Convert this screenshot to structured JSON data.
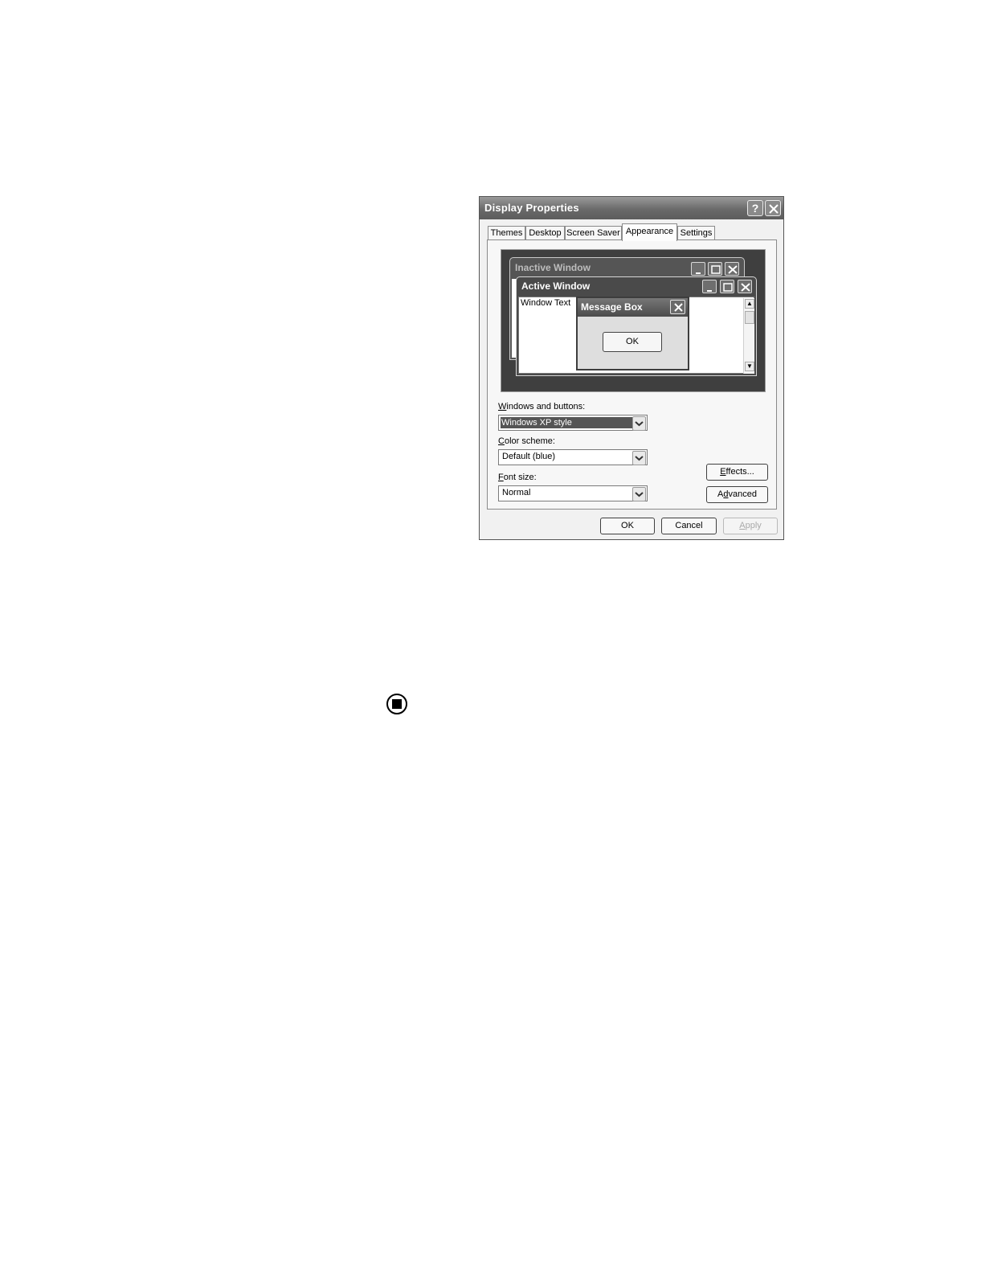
{
  "dialog": {
    "title": "Display Properties",
    "help_glyph": "?",
    "close_icon": "close-icon"
  },
  "tabs": [
    {
      "label": "Themes"
    },
    {
      "label": "Desktop"
    },
    {
      "label": "Screen Saver"
    },
    {
      "label": "Appearance",
      "active": true
    },
    {
      "label": "Settings"
    }
  ],
  "preview": {
    "inactive_title": "Inactive Window",
    "active_title": "Active Window",
    "window_text": "Window Text",
    "message_box_title": "Message Box",
    "message_box_ok": "OK"
  },
  "fields": {
    "windows_buttons": {
      "label_first": "W",
      "label_rest": "indows and buttons:",
      "value": "Windows XP style"
    },
    "color_scheme": {
      "label_first": "C",
      "label_rest": "olor scheme:",
      "value": "Default (blue)"
    },
    "font_size": {
      "label_first": "F",
      "label_rest": "ont size:",
      "value": "Normal"
    }
  },
  "side_buttons": {
    "effects": {
      "pre": "",
      "mnemonic": "E",
      "post": "ffects..."
    },
    "advanced": {
      "pre": "A",
      "mnemonic": "d",
      "post": "vanced"
    }
  },
  "footer_buttons": {
    "ok": "OK",
    "cancel_pre": "",
    "cancel_mnemonic": "",
    "cancel": "Cancel",
    "apply_mnemonic": "A",
    "apply_rest": "pply"
  },
  "colors": {
    "titlebar": "#6a6a6a",
    "preview_background": "#3f3f3f",
    "dialog_face": "#f1f1f1"
  },
  "icons": {
    "stop": "stop-icon"
  }
}
